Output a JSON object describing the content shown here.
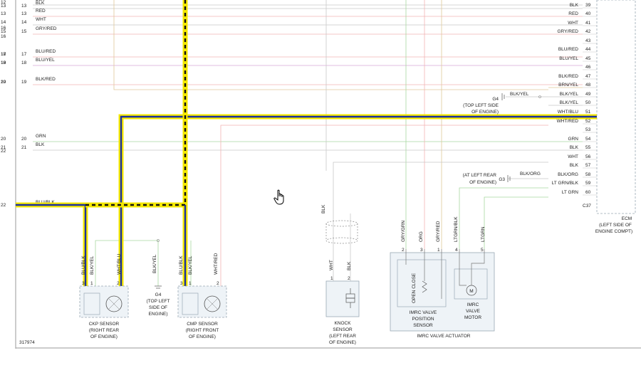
{
  "colors": {
    "highlight_yellow": "#f4e800",
    "highlight_blue": "#1a2fa0",
    "wire_pink": "#f2b4b4",
    "wire_green": "#a8d8a0",
    "wire_tan": "#e0c89a",
    "wire_grey": "#c8c8c8",
    "wire_lilac": "#d8a8d8",
    "component_fill": "#eef3f7",
    "component_stroke": "#9aa8b4"
  },
  "left_rows": [
    {
      "outer": "12",
      "pin": "",
      "color": "BLK"
    },
    {
      "outer": "13",
      "pin": "13",
      "color": "BLK"
    },
    {
      "outer": "13",
      "pin": "13",
      "color": "RED"
    },
    {
      "outer": "14",
      "pin": "14",
      "color": "WHT"
    },
    {
      "outer": "15",
      "pin": "15",
      "color": "GRY/RED"
    },
    {
      "outer": "17",
      "pin": "17",
      "color": "BLU/RED"
    },
    {
      "outer": "18",
      "pin": "18",
      "color": "BLU/YEL"
    },
    {
      "outer": "19",
      "pin": "19",
      "color": "BLK/RED"
    },
    {
      "outer": "20",
      "pin": "20",
      "color": "GRN"
    },
    {
      "outer": "21",
      "pin": "21",
      "color": "BLK"
    },
    {
      "outer": "22",
      "pin": "22",
      "color": "BLU/BLK"
    }
  ],
  "left_orphans": [
    "16",
    "16",
    "18",
    "19",
    "20",
    "22"
  ],
  "right_pins": [
    {
      "pin": "39",
      "color": "BLK"
    },
    {
      "pin": "40",
      "color": "RED"
    },
    {
      "pin": "41",
      "color": "WHT"
    },
    {
      "pin": "42",
      "color": "GRY/RED"
    },
    {
      "pin": "43",
      "color": ""
    },
    {
      "pin": "44",
      "color": "BLU/RED"
    },
    {
      "pin": "45",
      "color": "BLU/YEL"
    },
    {
      "pin": "46",
      "color": ""
    },
    {
      "pin": "47",
      "color": "BLK/RED"
    },
    {
      "pin": "48",
      "color": "BRN/YEL"
    },
    {
      "pin": "49",
      "color": "BLK/YEL"
    },
    {
      "pin": "50",
      "color": "BLK/YEL"
    },
    {
      "pin": "51",
      "color": "WHT/BLU"
    },
    {
      "pin": "52",
      "color": "WHT/RED"
    },
    {
      "pin": "53",
      "color": ""
    },
    {
      "pin": "54",
      "color": "GRN"
    },
    {
      "pin": "55",
      "color": "BLK"
    },
    {
      "pin": "56",
      "color": "WHT"
    },
    {
      "pin": "57",
      "color": "BLK"
    },
    {
      "pin": "58",
      "color": "BLK/ORG"
    },
    {
      "pin": "59",
      "color": "LT GRN/BLK"
    },
    {
      "pin": "60",
      "color": "LT GRN"
    }
  ],
  "connector_label": "C37",
  "ecm_label": [
    "ECM",
    "(LEFT SIDE OF",
    "ENGINE COMPT)"
  ],
  "g4_upper": {
    "name": "G4",
    "wire": "BLK/YEL",
    "location": [
      "(TOP LEFT SIDE",
      "OF ENGINE)"
    ]
  },
  "g3": {
    "name": "G3",
    "wire": "BLK/ORG",
    "location": [
      "(AT LEFT REAR",
      "OF ENGINE)"
    ]
  },
  "ckp": {
    "pins": [
      "3",
      "1",
      "2"
    ],
    "wires": [
      "BLU/BLK",
      "BLK/YEL",
      "WHT/BLU"
    ],
    "label": [
      "CKP SENSOR",
      "(RIGHT REAR",
      "OF ENGINE)"
    ]
  },
  "g4_lower": {
    "wire": "BLK/YEL",
    "label": [
      "G4",
      "(TOP LEFT",
      "SIDE OF",
      "ENGINE)"
    ]
  },
  "cmp": {
    "pins": [
      "3",
      "1",
      "2"
    ],
    "wires": [
      "BLU/BLK",
      "BLK/YEL",
      "WHT/RED"
    ],
    "label": [
      "CMP SENSOR",
      "(RIGHT FRONT",
      "OF ENGINE)"
    ]
  },
  "knock": {
    "shield_wire": "BLK",
    "pins": [
      "1",
      "2"
    ],
    "wires": [
      "WHT",
      "BLK"
    ],
    "label": [
      "KNOCK",
      "SENSOR",
      "(LEFT REAR",
      "OF ENGINE)"
    ]
  },
  "imrc": {
    "pins": [
      "2",
      "3",
      "1",
      "4",
      "5"
    ],
    "wires": [
      "GRY/GRN",
      "ORG",
      "GRY/RED",
      "LTGRN/BLK",
      "LTGRN"
    ],
    "open_close": "OPEN  CLOSE",
    "pos_label": [
      "IMRC VALVE",
      "POSITION",
      "SENSOR"
    ],
    "motor_label": [
      "IMRC",
      "VALVE",
      "MOTOR"
    ],
    "motor_symbol": "M",
    "actuator_label": "IMRC VALVE ACTUATOR"
  },
  "figure_number": "317974"
}
